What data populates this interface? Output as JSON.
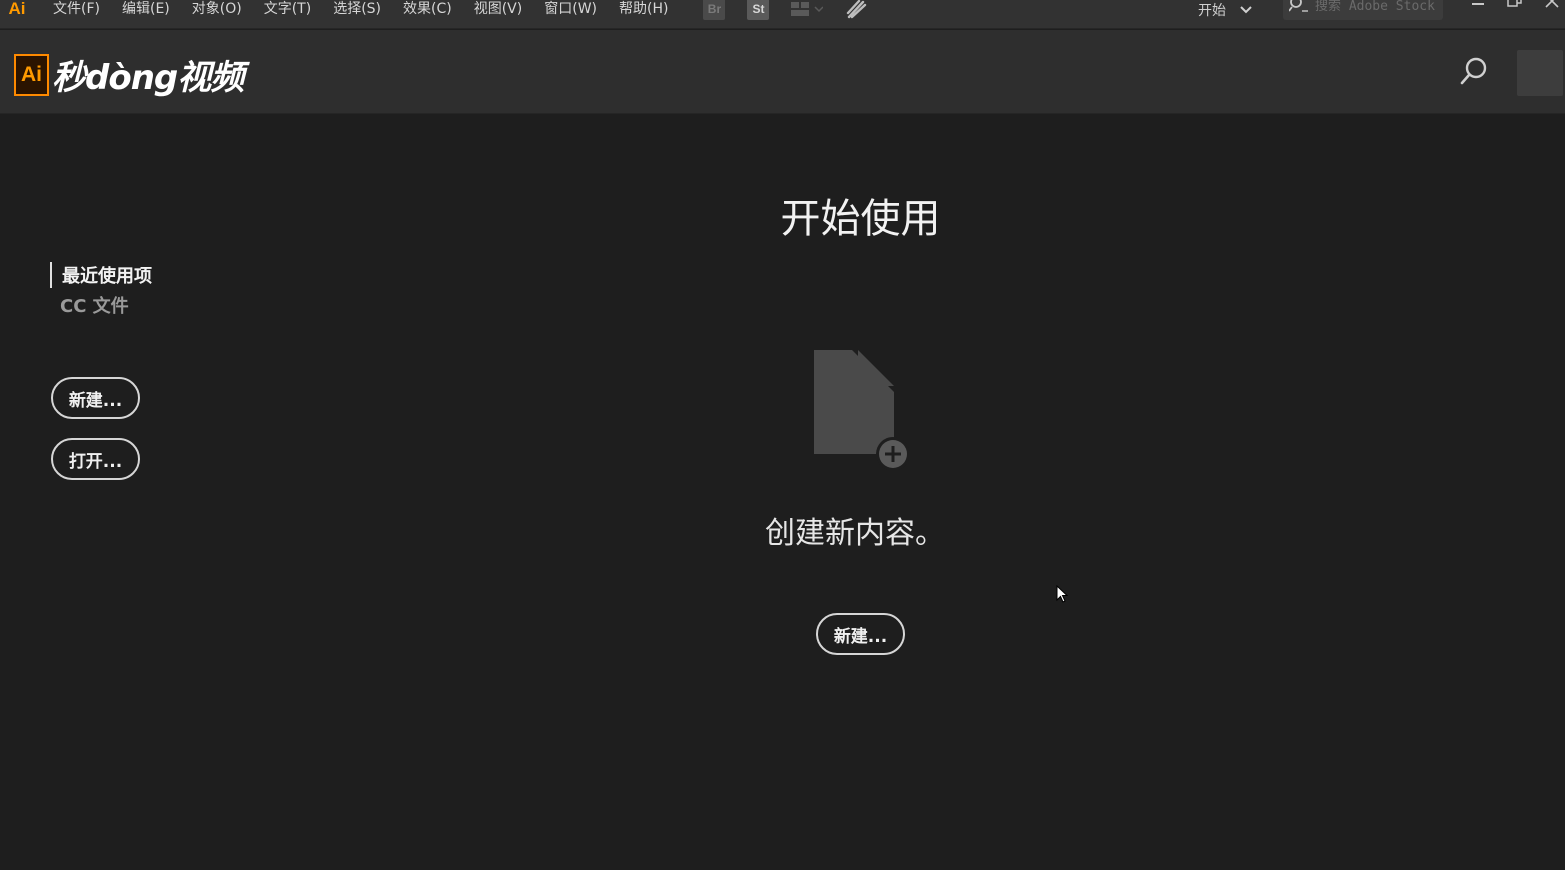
{
  "app": {
    "logo": "Ai"
  },
  "menu": [
    "文件(F)",
    "编辑(E)",
    "对象(O)",
    "文字(T)",
    "选择(S)",
    "效果(C)",
    "视图(V)",
    "窗口(W)",
    "帮助(H)"
  ],
  "toolbar": {
    "bridge": "Br",
    "stock": "St"
  },
  "workspace": {
    "label": "开始"
  },
  "stock_search": {
    "placeholder": "搜索 Adobe Stock"
  },
  "header": {
    "brand_ai": "Ai",
    "brand_text": "秒dòng视频"
  },
  "sidebar": {
    "items": [
      {
        "label": "最近使用项"
      },
      {
        "label": "CC 文件"
      }
    ],
    "new_label": "新建...",
    "open_label": "打开..."
  },
  "main": {
    "title": "开始使用",
    "create_text": "创建新内容。",
    "new_label": "新建..."
  },
  "colors": {
    "accent": "#ff9a00",
    "background": "#1e1e1e",
    "header": "#2e2e2e",
    "menubar": "#323232"
  }
}
